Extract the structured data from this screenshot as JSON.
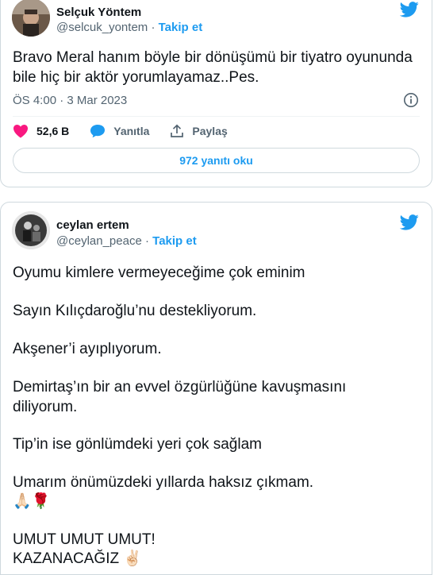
{
  "tweet1": {
    "display_name": "Selçuk Yöntem",
    "handle": "@selcuk_yontem",
    "separator": "·",
    "follow_label": "Takip et",
    "text": "Bravo Meral hanım böyle bir dönüşümü bir tiyatro oyununda bile hiç bir aktör yorumlayamaz..Pes.",
    "timestamp": "ÖS 4:00 · 3 Mar 2023",
    "like_count": "52,6 B",
    "reply_label": "Yanıtla",
    "share_label": "Paylaş",
    "read_replies_label": "972 yanıtı oku"
  },
  "tweet2": {
    "display_name": "ceylan ertem",
    "handle": "@ceylan_peace",
    "separator": "·",
    "follow_label": "Takip et",
    "lines": [
      "Oyumu kimlere vermeyeceğime çok eminim",
      "Sayın Kılıçdaroğlu’nu destekliyorum.",
      "Akşener’i ayıplıyorum.",
      "Demirtaş’ın bir an evvel özgürlüğüne kavuşmasını diliyorum.",
      "Tip’in ise gönlümdeki yeri çok sağlam",
      "Umarım önümüzdeki yıllarda haksız çıkmam.",
      "🙏🏻🌹",
      "UMUT UMUT UMUT!",
      "KAZANACAĞIZ ✌🏻"
    ]
  },
  "colors": {
    "accent": "#1d9bf0",
    "like": "#f91880",
    "muted": "#536471",
    "text": "#0f1419"
  },
  "icons": [
    "twitter-bird-icon",
    "info-icon",
    "heart-icon",
    "reply-bubble-icon",
    "share-icon"
  ]
}
